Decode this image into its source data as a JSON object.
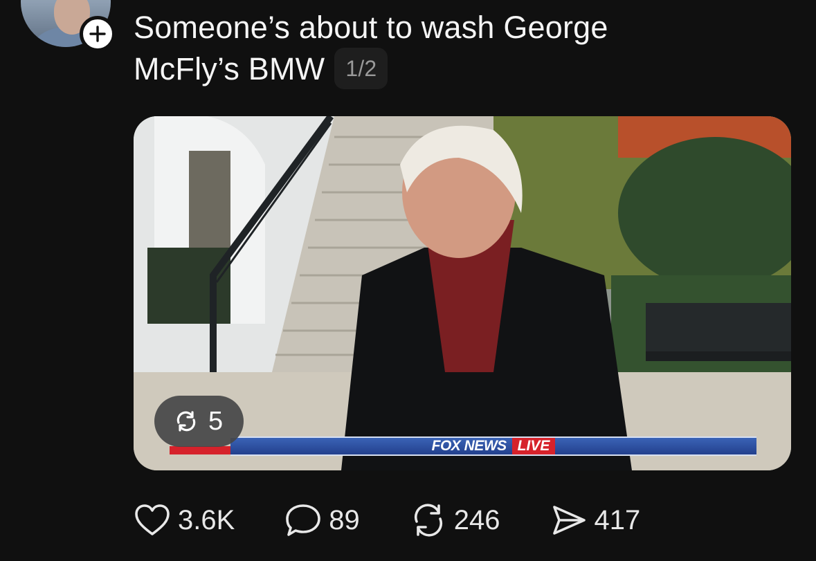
{
  "post": {
    "text_line1": "Someone’s about to wash George",
    "text_line2": "McFly’s BMW",
    "page_counter": "1/2"
  },
  "media": {
    "repost_badge_count": "5",
    "tv_brand": "FOX NEWS",
    "tv_live": "LIVE"
  },
  "actions": {
    "likes": "3.6K",
    "replies": "89",
    "reposts": "246",
    "shares": "417"
  },
  "icons": {
    "follow": "plus-icon",
    "like": "heart-icon",
    "reply": "comment-bubble-icon",
    "repost": "repost-arrows-icon",
    "share": "send-arrow-icon"
  },
  "colors": {
    "background": "#101010",
    "text": "#f5f5f5",
    "muted": "#9a9a9a",
    "badge": "#464648"
  }
}
